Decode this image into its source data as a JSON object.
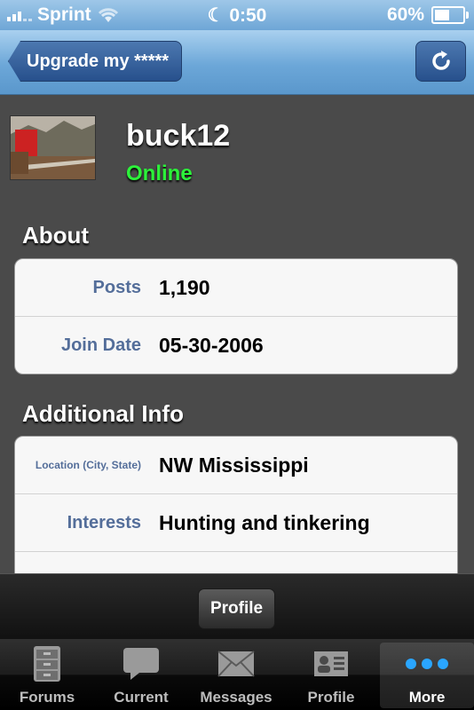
{
  "status_bar": {
    "carrier": "Sprint",
    "time": "0:50",
    "battery": "60%",
    "battery_level": 0.6
  },
  "nav": {
    "back_label": "Upgrade my *****",
    "refresh_icon": "refresh-icon"
  },
  "profile": {
    "username": "buck12",
    "status": "Online"
  },
  "about": {
    "title": "About",
    "rows": [
      {
        "label": "Posts",
        "value": "1,190"
      },
      {
        "label": "Join Date",
        "value": "05-30-2006"
      }
    ]
  },
  "additional": {
    "title": "Additional Info",
    "rows": [
      {
        "label": "Location (City, State)",
        "value": "NW Mississippi"
      },
      {
        "label": "Interests",
        "value": "Hunting and tinkering"
      }
    ]
  },
  "bottom": {
    "segment_label": "Profile"
  },
  "tabs": [
    {
      "label": "Forums",
      "icon": "filing-cabinet-icon"
    },
    {
      "label": "Current",
      "icon": "speech-bubble-icon"
    },
    {
      "label": "Messages",
      "icon": "envelope-icon"
    },
    {
      "label": "Profile",
      "icon": "id-card-icon"
    },
    {
      "label": "More",
      "icon": "more-dots-icon"
    }
  ],
  "colors": {
    "online": "#2cf23a",
    "label": "#546e9a",
    "nav_tint": "#6ca7d8"
  }
}
